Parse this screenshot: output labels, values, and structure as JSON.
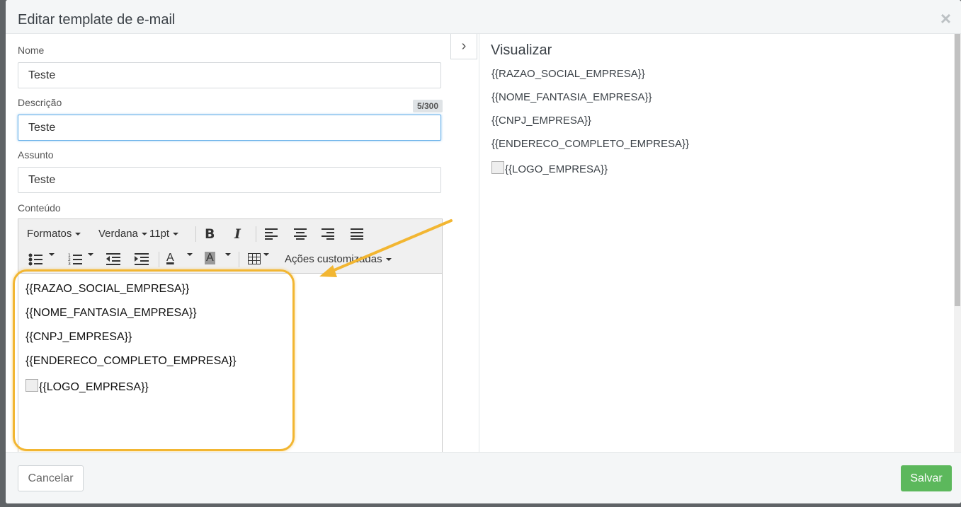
{
  "modal": {
    "title": "Editar template de e-mail",
    "close_icon": "×"
  },
  "form": {
    "name": {
      "label": "Nome",
      "value": "Teste"
    },
    "description": {
      "label": "Descrição",
      "value": "Teste",
      "counter": "5/300"
    },
    "subject": {
      "label": "Assunto",
      "value": "Teste"
    },
    "content": {
      "label": "Conteúdo"
    }
  },
  "toolbar": {
    "formats": "Formatos",
    "font": "Verdana",
    "size": "11pt",
    "bold": "B",
    "italic": "I",
    "custom_actions": "Ações customizadas",
    "font_color_glyph": "A",
    "bg_color_glyph": "A"
  },
  "content_lines": [
    "{{RAZAO_SOCIAL_EMPRESA}}",
    "{{NOME_FANTASIA_EMPRESA}}",
    "{{CNPJ_EMPRESA}}",
    "{{ENDERECO_COMPLETO_EMPRESA}}",
    "{{LOGO_EMPRESA}}"
  ],
  "preview": {
    "title": "Visualizar",
    "lines": [
      "{{RAZAO_SOCIAL_EMPRESA}}",
      "{{NOME_FANTASIA_EMPRESA}}",
      "{{CNPJ_EMPRESA}}",
      "{{ENDERECO_COMPLETO_EMPRESA}}",
      "{{LOGO_EMPRESA}}"
    ]
  },
  "footer": {
    "cancel": "Cancelar",
    "save": "Salvar"
  },
  "colors": {
    "highlight": "#f2b632",
    "save": "#5cb85c",
    "focus": "#66afe9"
  }
}
